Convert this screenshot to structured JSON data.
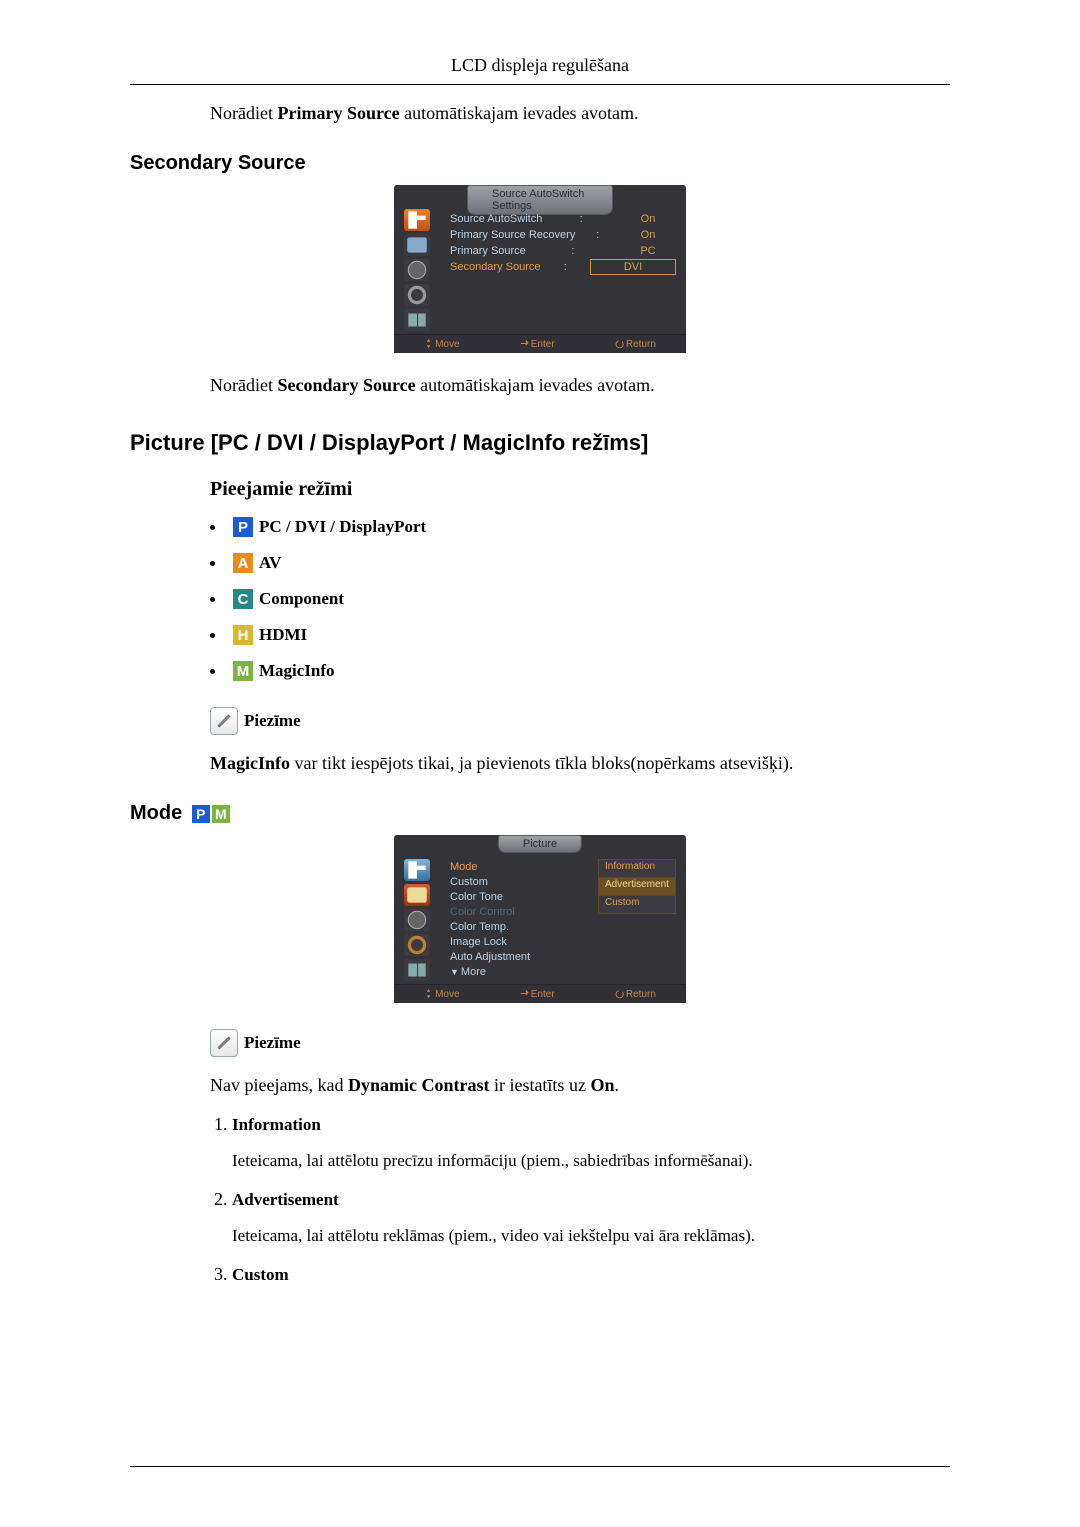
{
  "header": "LCD displeja regulēšana",
  "primarySourceText": {
    "pre": "Norādiet ",
    "bold": "Primary Source",
    "post": " automātiskajam ievades avotam."
  },
  "secondarySourceHeading": "Secondary Source",
  "osd1": {
    "title": "Source AutoSwitch Settings",
    "rows": [
      {
        "label": "Source AutoSwitch",
        "value": "On"
      },
      {
        "label": "Primary Source Recovery",
        "value": "On"
      },
      {
        "label": "Primary Source",
        "value": "PC"
      },
      {
        "label": "Secondary Source",
        "value": "DVI",
        "boxed": true
      }
    ],
    "bottom": {
      "move": "Move",
      "enter": "Enter",
      "return": "Return"
    }
  },
  "secondarySourceText": {
    "pre": "Norādiet ",
    "bold": "Secondary Source",
    "post": " automātiskajam ievades avotam."
  },
  "pictureHeading": "Picture [PC / DVI / DisplayPort / MagicInfo režīms]",
  "availableModesHeading": "Pieejamie režīmi",
  "modes": [
    {
      "icon": "P",
      "color": "bg-blue",
      "label": "PC / DVI / DisplayPort"
    },
    {
      "icon": "A",
      "color": "bg-orange",
      "label": "AV"
    },
    {
      "icon": "C",
      "color": "bg-teal",
      "label": "Component"
    },
    {
      "icon": "H",
      "color": "bg-yellow",
      "label": "HDMI"
    },
    {
      "icon": "M",
      "color": "bg-green",
      "label": "MagicInfo"
    }
  ],
  "noteLabel": "Piezīme",
  "magicInfoNote": {
    "bold": "MagicInfo",
    "post": " var tikt iespējots tikai, ja pievienots tīkla bloks(nopērkams atsevišķi)."
  },
  "modeHeading": "Mode",
  "osd2": {
    "title": "Picture",
    "menu": [
      {
        "label": "Mode",
        "sel": true
      },
      {
        "label": "Custom"
      },
      {
        "label": "Color Tone"
      },
      {
        "label": "Color Control",
        "dim": true
      },
      {
        "label": "Color Temp."
      },
      {
        "label": "Image Lock"
      },
      {
        "label": "Auto Adjustment"
      },
      {
        "label": "More",
        "arrow": true
      }
    ],
    "submenu": [
      {
        "label": "Information"
      },
      {
        "label": "Advertisement",
        "sel": true
      },
      {
        "label": "Custom"
      }
    ],
    "bottom": {
      "move": "Move",
      "enter": "Enter",
      "return": "Return"
    }
  },
  "dynamicContrastNote": {
    "pre": "Nav pieejams, kad ",
    "bold1": "Dynamic Contrast",
    "mid": " ir iestatīts uz ",
    "bold2": "On",
    "post": "."
  },
  "list": [
    {
      "title": "Information",
      "desc": "Ieteicama, lai attēlotu precīzu informāciju (piem., sabiedrības informēšanai)."
    },
    {
      "title": "Advertisement",
      "desc": "Ieteicama, lai attēlotu reklāmas (piem., video vai iekštelpu vai āra reklāmas)."
    },
    {
      "title": "Custom",
      "desc": ""
    }
  ]
}
